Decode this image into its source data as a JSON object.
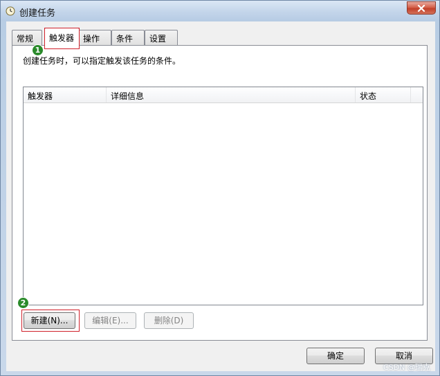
{
  "window": {
    "title": "创建任务"
  },
  "tabs": [
    {
      "label": "常规",
      "active": false
    },
    {
      "label": "触发器",
      "active": true
    },
    {
      "label": "操作",
      "active": false
    },
    {
      "label": "条件",
      "active": false
    },
    {
      "label": "设置",
      "active": false
    }
  ],
  "triggers_panel": {
    "description": "创建任务时，可以指定触发该任务的条件。",
    "columns": [
      "触发器",
      "详细信息",
      "状态"
    ],
    "rows": []
  },
  "buttons": {
    "new": "新建(N)...",
    "edit": "编辑(E)...",
    "delete": "删除(D)",
    "ok": "确定",
    "cancel": "取消"
  },
  "annotations": {
    "badge1": "1",
    "badge2": "2"
  },
  "watermark": "CSDN @瑞克",
  "colors": {
    "highlight": "#d0202a",
    "badge": "#2a8a2a",
    "close": "#c2402a"
  }
}
